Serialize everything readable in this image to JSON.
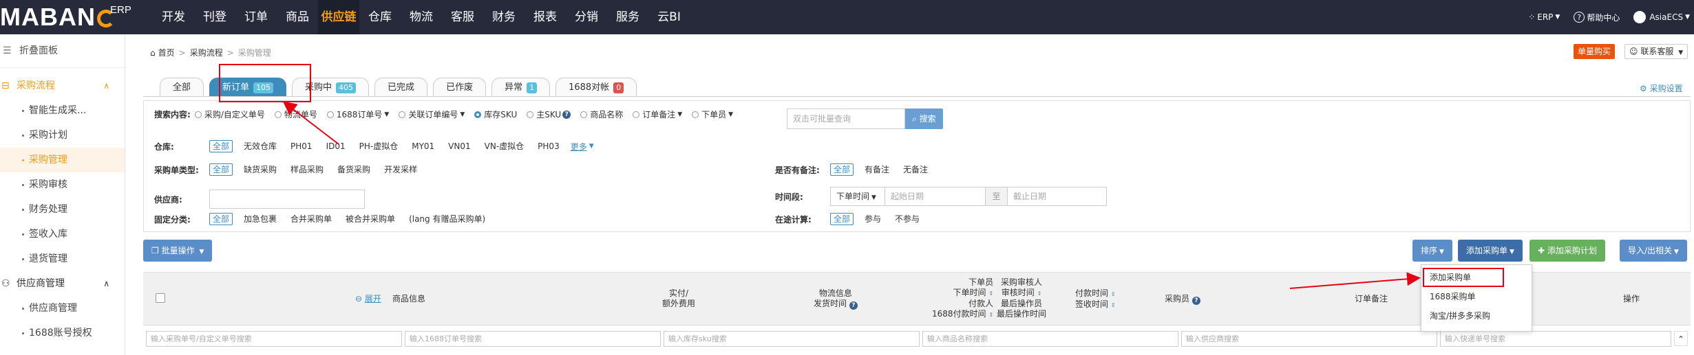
{
  "brand": {
    "logo": "MABANG",
    "erp": "ERP"
  },
  "nav": [
    "开发",
    "刊登",
    "订单",
    "商品",
    "供应链",
    "仓库",
    "物流",
    "客服",
    "财务",
    "报表",
    "分销",
    "服务",
    "云BI"
  ],
  "top_right": {
    "erp": "ERP",
    "help": "帮助中心",
    "user": "AsiaECS"
  },
  "sidebar": {
    "fold": "折叠面板",
    "group1": "采购流程",
    "group1_items": [
      "智能生成采...",
      "采购计划",
      "采购管理",
      "采购审核",
      "财务处理",
      "签收入库",
      "退货管理"
    ],
    "group2": "供应商管理",
    "group2_items": [
      "供应商管理",
      "1688账号授权"
    ]
  },
  "breadcrumb": {
    "home": "首页",
    "level2": "采购流程",
    "level3": "采购管理"
  },
  "header_buttons": {
    "buy": "单量购买",
    "service": "联系客服"
  },
  "tabs": [
    {
      "label": "全部",
      "badge": ""
    },
    {
      "label": "新订单",
      "badge": "105"
    },
    {
      "label": "采购中",
      "badge": "405"
    },
    {
      "label": "已完成",
      "badge": ""
    },
    {
      "label": "已作废",
      "badge": ""
    },
    {
      "label": "异常",
      "badge": "1"
    },
    {
      "label": "1688对帐",
      "badge": "0"
    }
  ],
  "purchase_settings": "采购设置",
  "search": {
    "label": "搜索内容:",
    "options": [
      "采购/自定义单号",
      "物流单号",
      "1688订单号",
      "关联订单编号",
      "库存SKU",
      "主SKU",
      "商品名称",
      "订单备注",
      "下单员"
    ],
    "placeholder": "双击可批量查询",
    "button": "搜索"
  },
  "warehouse": {
    "label": "仓库:",
    "options": [
      "全部",
      "无效仓库",
      "PH01",
      "ID01",
      "PH-虚拟仓",
      "MY01",
      "VN01",
      "VN-虚拟仓",
      "PH03"
    ],
    "more": "更多"
  },
  "order_type": {
    "label": "采购单类型:",
    "options": [
      "全部",
      "缺货采购",
      "样品采购",
      "备货采购",
      "开发采样"
    ]
  },
  "supplier": {
    "label": "供应商:"
  },
  "fixed_class": {
    "label": "固定分类:",
    "options": [
      "全部",
      "加急包裹",
      "合并采购单",
      "被合并采购单",
      "(lang 有赠品采购单)"
    ]
  },
  "remark": {
    "label": "是否有备注:",
    "options": [
      "全部",
      "有备注",
      "无备注"
    ]
  },
  "time": {
    "label": "时间段:",
    "select": "下单时间",
    "start": "起始日期",
    "to": "至",
    "end": "截止日期"
  },
  "in_transit": {
    "label": "在途计算:",
    "options": [
      "全部",
      "参与",
      "不参与"
    ]
  },
  "actions": {
    "bulk": "批量操作",
    "sort": "排序",
    "add": "添加采购单",
    "add_plan": "添加采购计划",
    "import_export": "导入/出相关"
  },
  "dropdown": [
    "添加采购单",
    "1688采购单",
    "淘宝/拼多多采购"
  ],
  "table": {
    "expand": "展开",
    "goods": "商品信息",
    "paid1": "实付/",
    "paid2": "额外费用",
    "logistics1": "物流信息",
    "logistics2": "发货时间",
    "order_people": [
      "下单员",
      "下单时间",
      "付款人",
      "1688付款时间"
    ],
    "audit": [
      "采购审核人",
      "审核时间",
      "最后操作员",
      "最后操作时间"
    ],
    "pay_time": [
      "付款时间",
      "签收时间"
    ],
    "buyer": "采购员",
    "order_remark": "订单备注",
    "ops": "操作"
  },
  "filters": [
    "输入采购单号/自定义单号搜索",
    "输入1688订单号搜索",
    "输入库存sku搜索",
    "输入商品名称搜索",
    "输入供应商搜索",
    "输入快递单号搜索"
  ],
  "colors": {
    "accent": "#f39c12",
    "primary": "#3c8dbc",
    "nav_bg": "#262a3b",
    "annotation": "#e60012"
  }
}
